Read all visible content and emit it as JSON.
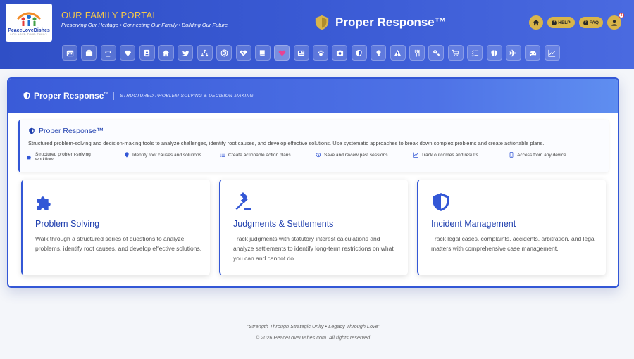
{
  "header": {
    "logo_text": "PeaceLoveDishes",
    "logo_tagline": "LIFE. LOVE. FOOD. FAMILY.",
    "portal_title": "OUR FAMILY PORTAL",
    "portal_subtitle": "Preserving Our Heritage • Connecting Our Family • Building Our Future",
    "brand_title": "Proper Response™",
    "help_label": "HELP",
    "faq_label": "FAQ",
    "notification_count": "4",
    "accent_color": "#d9b54a",
    "nav_icons": [
      "calendar-icon",
      "briefcase-icon",
      "scales-icon",
      "diamond-icon",
      "contact-book-icon",
      "home-icon",
      "bird-icon",
      "org-chart-icon",
      "target-icon",
      "heartbeat-icon",
      "book-icon",
      "heart-icon",
      "newspaper-icon",
      "paw-icon",
      "camera-icon",
      "shield-icon",
      "lightbulb-icon",
      "warning-icon",
      "utensils-icon",
      "key-icon",
      "cart-icon",
      "checklist-icon",
      "brain-icon",
      "plane-icon",
      "car-icon",
      "chart-icon"
    ]
  },
  "card": {
    "title": "Proper Response",
    "title_tm": "™",
    "subtitle": "STRUCTURED PROBLEM-SOLVING & DECISION-MAKING",
    "intro": {
      "title": "Proper Response™",
      "description": "Structured problem-solving and decision-making tools to analyze challenges, identify root causes, and develop effective solutions. Use systematic approaches to break down complex problems and create actionable plans.",
      "features": [
        {
          "icon": "puzzle-icon",
          "label": "Structured problem-solving workflow"
        },
        {
          "icon": "pin-icon",
          "label": "Identify root causes and solutions"
        },
        {
          "icon": "list-icon",
          "label": "Create actionable action plans"
        },
        {
          "icon": "history-icon",
          "label": "Save and review past sessions"
        },
        {
          "icon": "chart-icon",
          "label": "Track outcomes and results"
        },
        {
          "icon": "mobile-icon",
          "label": "Access from any device"
        }
      ]
    },
    "tools": [
      {
        "icon": "puzzle-icon",
        "title": "Problem Solving",
        "description": "Walk through a structured series of questions to analyze problems, identify root causes, and develop effective solutions."
      },
      {
        "icon": "gavel-icon",
        "title": "Judgments & Settlements",
        "description": "Track judgments with statutory interest calculations and analyze settlements to identify long-term restrictions on what you can and cannot do."
      },
      {
        "icon": "shield-icon",
        "title": "Incident Management",
        "description": "Track legal cases, complaints, accidents, arbitration, and legal matters with comprehensive case management."
      }
    ]
  },
  "footer": {
    "quote": "\"Strength Through Strategic Unity • Legacy Through Love\"",
    "copyright": "© 2026 PeaceLoveDishes.com. All rights reserved."
  }
}
